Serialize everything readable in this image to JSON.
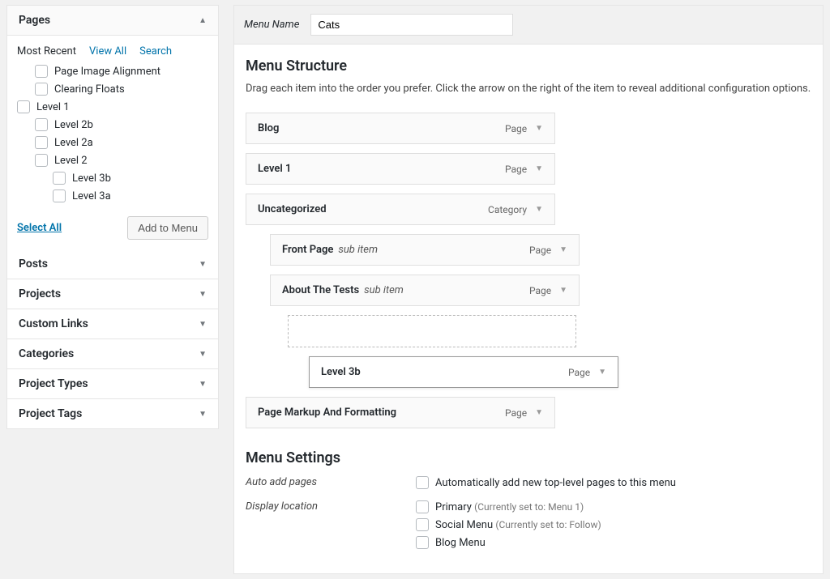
{
  "sidebar": {
    "pages_title": "Pages",
    "tabs": {
      "recent": "Most Recent",
      "all": "View All",
      "search": "Search"
    },
    "page_list": [
      {
        "label": "Page Image Alignment",
        "indent": 1
      },
      {
        "label": "Clearing Floats",
        "indent": 1
      },
      {
        "label": "Level 1",
        "indent": 0
      },
      {
        "label": "Level 2b",
        "indent": 1
      },
      {
        "label": "Level 2a",
        "indent": 1
      },
      {
        "label": "Level 2",
        "indent": 1
      },
      {
        "label": "Level 3b",
        "indent": 2
      },
      {
        "label": "Level 3a",
        "indent": 2
      }
    ],
    "select_all": "Select All",
    "add_to_menu": "Add to Menu",
    "panels": [
      "Posts",
      "Projects",
      "Custom Links",
      "Categories",
      "Project Types",
      "Project Tags"
    ]
  },
  "menu": {
    "name_label": "Menu Name",
    "name_value": "Cats",
    "structure_title": "Menu Structure",
    "structure_help": "Drag each item into the order you prefer. Click the arrow on the right of the item to reveal additional configuration options.",
    "items": [
      {
        "title": "Blog",
        "type": "Page",
        "indent": 0,
        "sub": ""
      },
      {
        "title": "Level 1",
        "type": "Page",
        "indent": 0,
        "sub": ""
      },
      {
        "title": "Uncategorized",
        "type": "Category",
        "indent": 0,
        "sub": ""
      },
      {
        "title": "Front Page",
        "type": "Page",
        "indent": 1,
        "sub": "sub item"
      },
      {
        "title": "About The Tests",
        "type": "Page",
        "indent": 1,
        "sub": "sub item"
      },
      {
        "title": "Level 3b",
        "type": "Page",
        "indent": 2,
        "sub": "",
        "dragging": true
      },
      {
        "title": "Page Markup And Formatting",
        "type": "Page",
        "indent": 0,
        "sub": ""
      }
    ],
    "settings_title": "Menu Settings",
    "auto_add_label": "Auto add pages",
    "auto_add_option": "Automatically add new top-level pages to this menu",
    "display_loc_label": "Display location",
    "locations": [
      {
        "label": "Primary",
        "hint": "(Currently set to: Menu 1)"
      },
      {
        "label": "Social Menu",
        "hint": "(Currently set to: Follow)"
      },
      {
        "label": "Blog Menu",
        "hint": ""
      }
    ]
  }
}
